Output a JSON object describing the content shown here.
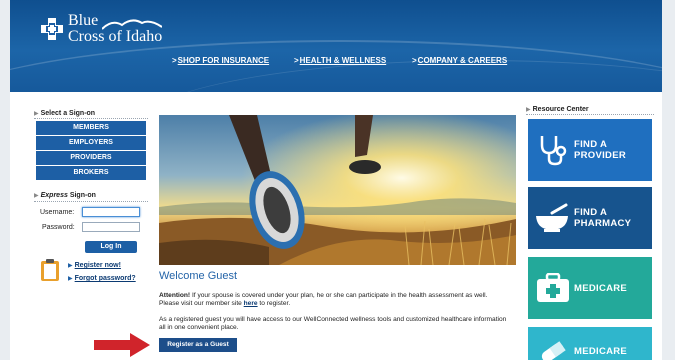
{
  "brand": {
    "line1": "Blue",
    "line2": "Cross of Idaho"
  },
  "nav": [
    {
      "label": "SHOP FOR INSURANCE"
    },
    {
      "label": "HEALTH & WELLNESS"
    },
    {
      "label": "COMPANY & CAREERS"
    }
  ],
  "signon": {
    "heading": "Select a Sign-on",
    "buttons": [
      "MEMBERS",
      "EMPLOYERS",
      "PROVIDERS",
      "BROKERS"
    ]
  },
  "express": {
    "heading_prefix": "Express",
    "heading_suffix": " Sign-on",
    "username_label": "Username:",
    "password_label": "Password:",
    "username_value": "",
    "password_value": "",
    "login_label": "Log In",
    "register_link": "Register now!",
    "forgot_link": "Forgot password?"
  },
  "main": {
    "welcome": "Welcome Guest",
    "attention_bold": "Attention!",
    "attention_text_1": " If your spouse is covered under your plan, he or she can participate in the health assessment as well. Please visit our member site ",
    "attention_link": "here",
    "attention_text_2": " to register.",
    "guest_text": "As a registered guest you will have access to our WellConnected wellness tools and customized healthcare information all in one convenient place.",
    "register_button": "Register as a Guest"
  },
  "resources": {
    "heading": "Resource Center",
    "tiles": [
      {
        "line1": "FIND A",
        "line2": "PROVIDER",
        "color": "#1f6fbf",
        "icon": "stethoscope-icon"
      },
      {
        "line1": "FIND A",
        "line2": "PHARMACY",
        "color": "#17548e",
        "icon": "mortar-pestle-icon"
      },
      {
        "line1": "MEDICARE",
        "line2": "",
        "color": "#23a99a",
        "icon": "medical-kit-icon"
      },
      {
        "line1": "MEDICARE",
        "line2": "",
        "color": "#2fb6cc",
        "icon": "pill-icon"
      }
    ]
  },
  "colors": {
    "brand_blue": "#1d5fa5",
    "header_blue": "#16599b",
    "arrow_red": "#d0242b"
  }
}
